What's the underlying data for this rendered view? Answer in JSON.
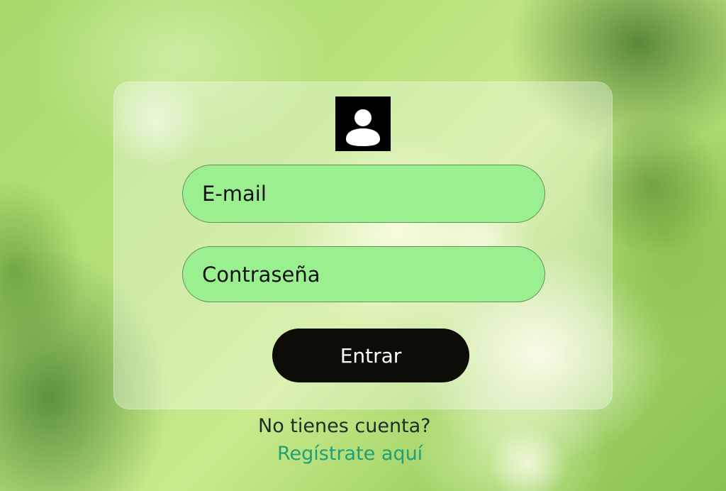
{
  "form": {
    "avatar_icon": "user-avatar-icon",
    "email": {
      "placeholder": "E-mail",
      "value": ""
    },
    "password": {
      "placeholder": "Contraseña",
      "value": ""
    },
    "submit_label": "Entrar"
  },
  "footer": {
    "prompt": "No tienes cuenta?",
    "register_link": "Regístrate aquí"
  },
  "colors": {
    "field_background": "#9af08e",
    "button_background": "#0e0c07",
    "button_text": "#ffffff",
    "link": "#1fa07a",
    "prompt_text": "#1d2d28"
  }
}
